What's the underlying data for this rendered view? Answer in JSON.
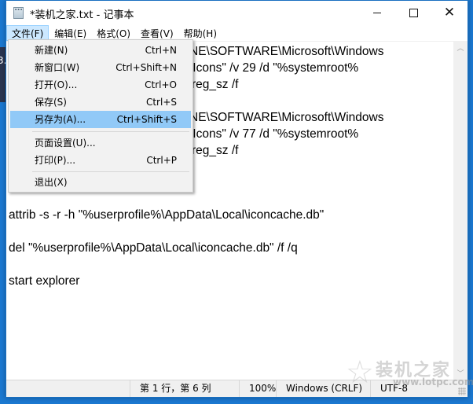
{
  "window": {
    "title": "*装机之家.txt - 记事本",
    "controls": {
      "minimize": "—",
      "maximize": "☐",
      "close": "✕"
    }
  },
  "desktop": {
    "fragment_text": "3."
  },
  "menubar": {
    "items": [
      {
        "label": "文件(F)",
        "active": true
      },
      {
        "label": "编辑(E)",
        "active": false
      },
      {
        "label": "格式(O)",
        "active": false
      },
      {
        "label": "查看(V)",
        "active": false
      },
      {
        "label": "帮助(H)",
        "active": false
      }
    ]
  },
  "file_menu": {
    "items": [
      {
        "label": "新建(N)",
        "shortcut": "Ctrl+N"
      },
      {
        "label": "新窗口(W)",
        "shortcut": "Ctrl+Shift+N"
      },
      {
        "label": "打开(O)...",
        "shortcut": "Ctrl+O"
      },
      {
        "label": "保存(S)",
        "shortcut": "Ctrl+S"
      },
      {
        "label": "另存为(A)...",
        "shortcut": "Ctrl+Shift+S",
        "highlighted": true
      },
      {
        "label": "页面设置(U)...",
        "shortcut": ""
      },
      {
        "label": "打印(P)...",
        "shortcut": "Ctrl+P"
      },
      {
        "label": "退出(X)",
        "shortcut": ""
      }
    ]
  },
  "editor": {
    "visible_lines": [
      "NE\\SOFTWARE\\Microsoft\\Windows",
      " Icons\" /v 29 /d \"%systemroot%",
      "reg_sz /f",
      "NE\\SOFTWARE\\Microsoft\\Windows",
      " Icons\" /v 77 /d \"%systemroot%",
      "reg_sz /f",
      "attrib -s -r -h \"%userprofile%\\AppData\\Local\\iconcache.db\"",
      "del \"%userprofile%\\AppData\\Local\\iconcache.db\" /f /q",
      "start explorer"
    ]
  },
  "scrollbar": {
    "up": "︿",
    "down": "﹀"
  },
  "statusbar": {
    "position": "第 1 行，第 6 列",
    "zoom": "100%",
    "line_ending": "Windows (CRLF)",
    "encoding": "UTF-8"
  },
  "watermark": {
    "star": "☆",
    "text": "装机之家",
    "url": "www.lotpc.com"
  },
  "colors": {
    "desktop": "#1b78d0",
    "menu_active": "#cce8ff",
    "menu_hover": "#91c9f7"
  }
}
